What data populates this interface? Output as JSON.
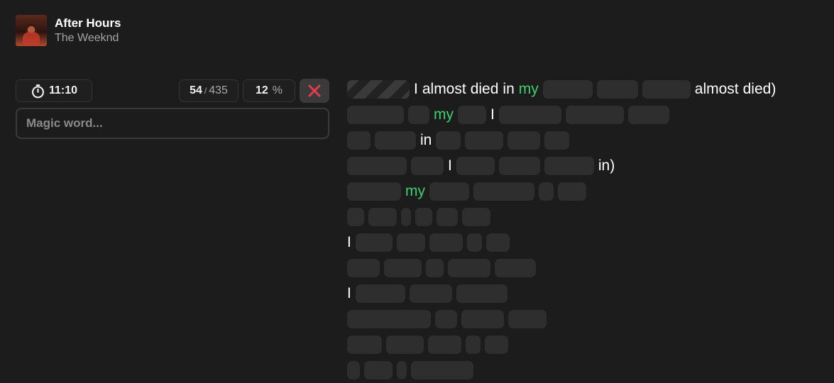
{
  "song": {
    "title": "After Hours",
    "artist": "The Weeknd"
  },
  "stats": {
    "timer": "11:10",
    "found": "54",
    "separator": "/",
    "total": "435",
    "percent": "12",
    "percent_symbol": "%"
  },
  "input": {
    "placeholder": "Magic word..."
  },
  "colors": {
    "highlight": "#3ecf6f",
    "give_up": "#e33b4b"
  },
  "lyrics": [
    [
      {
        "t": "blank",
        "w": 88,
        "striped": true
      },
      {
        "t": "word",
        "text": "I"
      },
      {
        "t": "word",
        "text": "almost"
      },
      {
        "t": "word",
        "text": "died"
      },
      {
        "t": "word",
        "text": "in"
      },
      {
        "t": "word",
        "text": "my",
        "hl": true
      },
      {
        "t": "blank",
        "w": 70
      },
      {
        "t": "blank",
        "w": 58
      },
      {
        "t": "blank",
        "w": 68
      },
      {
        "t": "word",
        "text": "almost"
      },
      {
        "t": "word",
        "text": "died)"
      }
    ],
    [
      {
        "t": "blank",
        "w": 80
      },
      {
        "t": "blank",
        "w": 30
      },
      {
        "t": "word",
        "text": "my",
        "hl": true
      },
      {
        "t": "blank",
        "w": 40
      },
      {
        "t": "word",
        "text": "I"
      },
      {
        "t": "blank",
        "w": 88
      },
      {
        "t": "blank",
        "w": 82
      },
      {
        "t": "blank",
        "w": 58
      }
    ],
    [
      {
        "t": "blank",
        "w": 33
      },
      {
        "t": "blank",
        "w": 58
      },
      {
        "t": "word",
        "text": "in"
      },
      {
        "t": "blank",
        "w": 35
      },
      {
        "t": "blank",
        "w": 54
      },
      {
        "t": "blank",
        "w": 46
      },
      {
        "t": "blank",
        "w": 35
      }
    ],
    [
      {
        "t": "blank",
        "w": 84
      },
      {
        "t": "blank",
        "w": 46
      },
      {
        "t": "word",
        "text": "I"
      },
      {
        "t": "blank",
        "w": 54
      },
      {
        "t": "blank",
        "w": 58
      },
      {
        "t": "blank",
        "w": 70
      },
      {
        "t": "word",
        "text": "in)"
      }
    ],
    [
      {
        "t": "blank",
        "w": 76
      },
      {
        "t": "word",
        "text": "my",
        "hl": true
      },
      {
        "t": "blank",
        "w": 56
      },
      {
        "t": "blank",
        "w": 86
      },
      {
        "t": "blank",
        "w": 21
      },
      {
        "t": "blank",
        "w": 40
      }
    ],
    [
      {
        "t": "blank",
        "w": 24
      },
      {
        "t": "blank",
        "w": 40
      },
      {
        "t": "blank",
        "w": 14
      },
      {
        "t": "blank",
        "w": 24
      },
      {
        "t": "blank",
        "w": 30
      },
      {
        "t": "blank",
        "w": 40
      }
    ],
    [
      {
        "t": "word",
        "text": "I"
      },
      {
        "t": "blank",
        "w": 52
      },
      {
        "t": "blank",
        "w": 40
      },
      {
        "t": "blank",
        "w": 47
      },
      {
        "t": "blank",
        "w": 21
      },
      {
        "t": "blank",
        "w": 33
      }
    ],
    [
      {
        "t": "blank",
        "w": 46
      },
      {
        "t": "blank",
        "w": 53
      },
      {
        "t": "blank",
        "w": 25
      },
      {
        "t": "blank",
        "w": 60
      },
      {
        "t": "blank",
        "w": 58
      }
    ],
    [
      {
        "t": "word",
        "text": "I"
      },
      {
        "t": "blank",
        "w": 70
      },
      {
        "t": "blank",
        "w": 60
      },
      {
        "t": "blank",
        "w": 72
      }
    ],
    [
      {
        "t": "blank",
        "w": 118
      },
      {
        "t": "blank",
        "w": 31
      },
      {
        "t": "blank",
        "w": 60
      },
      {
        "t": "blank",
        "w": 54
      }
    ],
    [
      {
        "t": "blank",
        "w": 49
      },
      {
        "t": "blank",
        "w": 53
      },
      {
        "t": "blank",
        "w": 47
      },
      {
        "t": "blank",
        "w": 21
      },
      {
        "t": "blank",
        "w": 33
      }
    ],
    [
      {
        "t": "blank",
        "w": 18
      },
      {
        "t": "blank",
        "w": 40
      },
      {
        "t": "blank",
        "w": 14
      },
      {
        "t": "blank",
        "w": 88
      }
    ]
  ]
}
